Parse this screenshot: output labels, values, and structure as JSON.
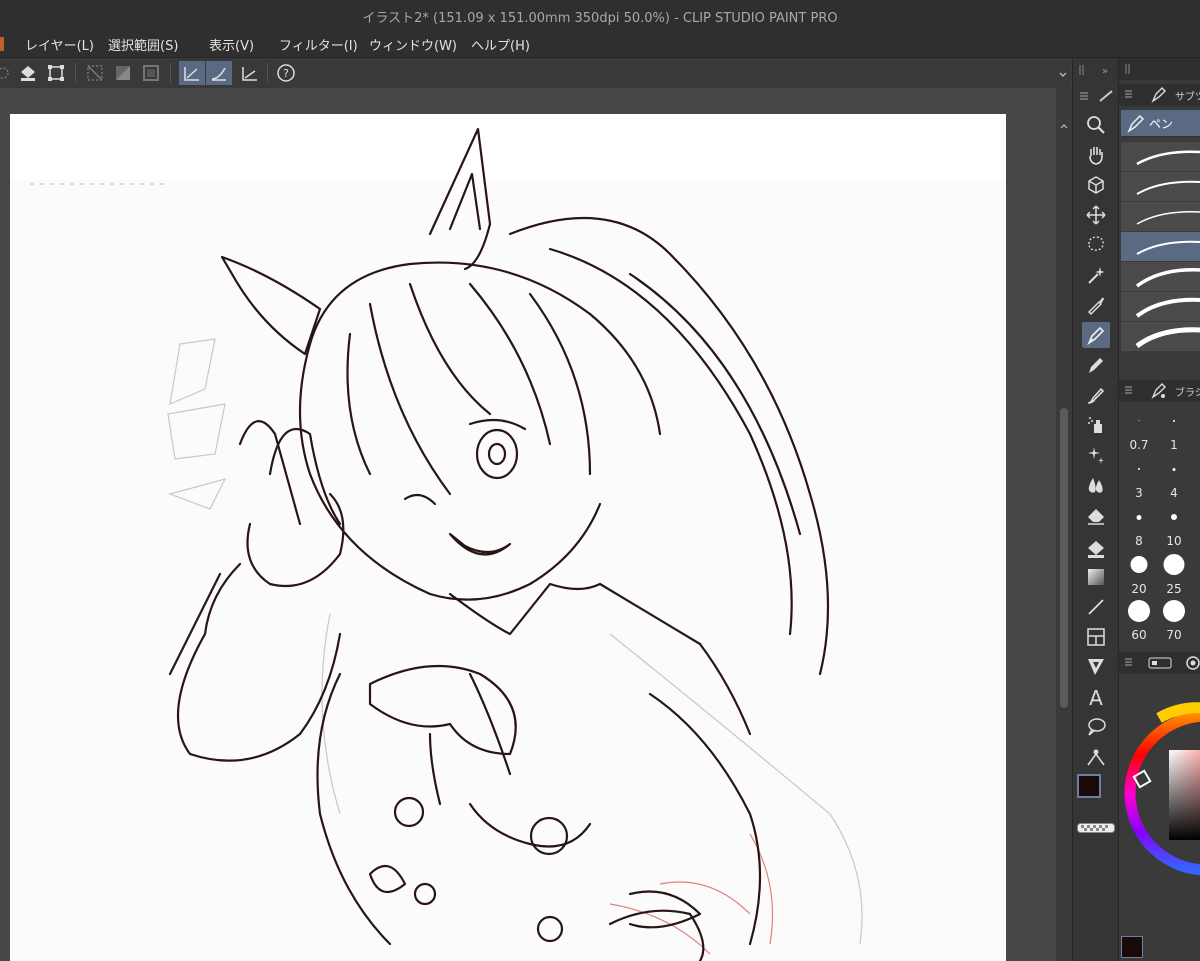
{
  "window": {
    "title": "イラスト2* (151.09 x 151.00mm 350dpi 50.0%)  - CLIP STUDIO PAINT PRO"
  },
  "menu": [
    "レイヤー(L)",
    "選択範囲(S)",
    "表示(V)",
    "フィルター(I)",
    "ウィンドウ(W)",
    "ヘルプ(H)"
  ],
  "subtool_panel": {
    "tab_label": "サブツ",
    "selected_tool": "ペン"
  },
  "brush_size_panel": {
    "tab_label": "ブラシ",
    "sizes": [
      "0.7",
      "1",
      "3",
      "4",
      "8",
      "10",
      "20",
      "25",
      "60",
      "70"
    ]
  },
  "colors": {
    "main_color": "#1a0a0a",
    "sub_color": "#ffffff",
    "accent": "#5a6a82"
  }
}
